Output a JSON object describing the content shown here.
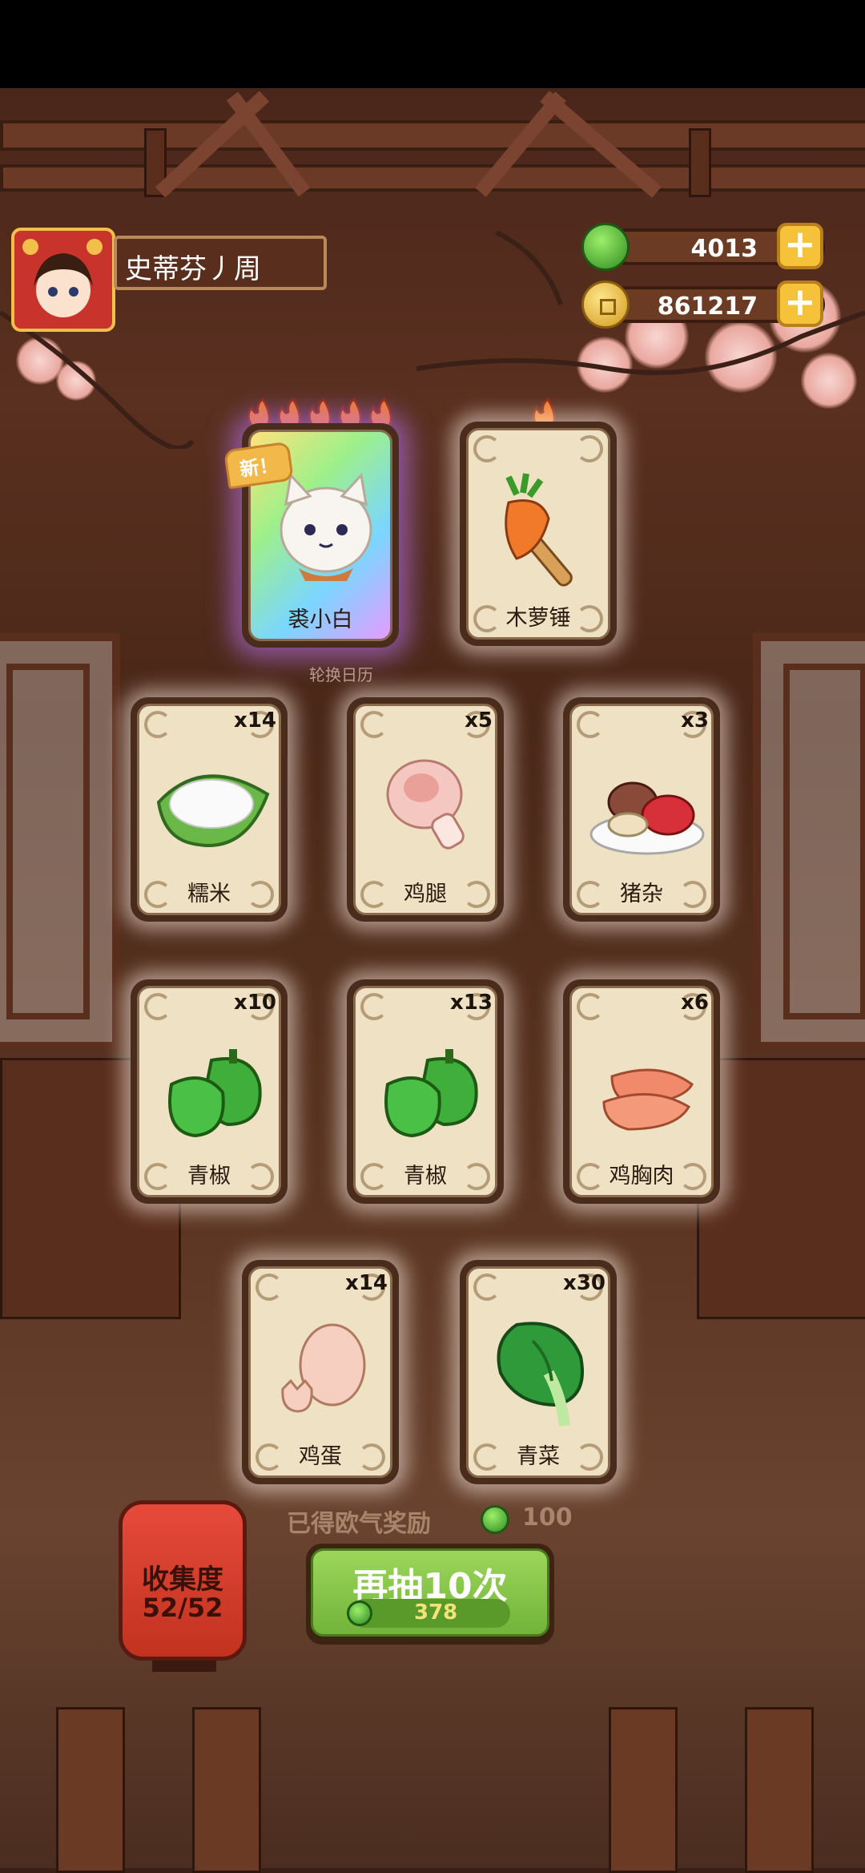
{
  "player": {
    "name": "史蒂芬丿周"
  },
  "currency": {
    "jade": "4013",
    "coins": "861217"
  },
  "top_cards": [
    {
      "label": "裘小白",
      "stars": 5,
      "badge": "新！"
    },
    {
      "label": "木萝锤",
      "stars": 1
    }
  ],
  "hint_text": "轮换日历",
  "items": [
    {
      "label": "糯米",
      "count": "x14",
      "icon": "rice-icon"
    },
    {
      "label": "鸡腿",
      "count": "x5",
      "icon": "drumstick-icon"
    },
    {
      "label": "猪杂",
      "count": "x3",
      "icon": "offal-icon"
    },
    {
      "label": "青椒",
      "count": "x10",
      "icon": "green-pepper-icon"
    },
    {
      "label": "青椒",
      "count": "x13",
      "icon": "green-pepper-icon"
    },
    {
      "label": "鸡胸肉",
      "count": "x6",
      "icon": "chicken-breast-icon"
    },
    {
      "label": "鸡蛋",
      "count": "x14",
      "icon": "egg-icon"
    },
    {
      "label": "青菜",
      "count": "x30",
      "icon": "greens-icon"
    }
  ],
  "reward": {
    "label": "已得欧气奖励",
    "value": "100"
  },
  "collection": {
    "title": "收集度",
    "progress": "52/52"
  },
  "draw": {
    "label": "再抽10次",
    "cost": "378"
  },
  "colors": {
    "accent_green": "#7cc043",
    "gold": "#f6c23a"
  }
}
